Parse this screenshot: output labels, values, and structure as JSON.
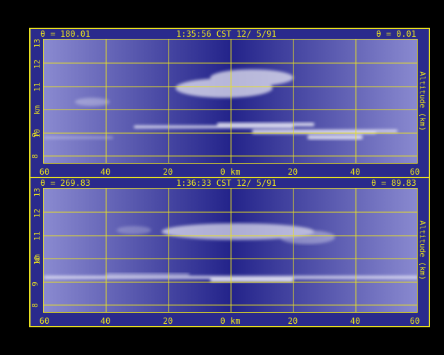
{
  "panels": [
    {
      "theta_left": "θ = 180.01",
      "time": "1:35:56 CST 12/ 5/91",
      "theta_right": "θ = 0.01",
      "y_axis_label": "km",
      "right_label": "Altitude (km)",
      "y_ticks": [
        "8",
        "9",
        "10",
        "11",
        "12",
        "13"
      ],
      "x_ticks": [
        "60",
        "40",
        "20",
        "0 km",
        "20",
        "40",
        "60"
      ]
    },
    {
      "theta_left": "θ = 269.83",
      "time": "1:36:33 CST 12/ 5/91",
      "theta_right": "θ = 89.83",
      "y_axis_label": "km",
      "right_label": "Altitude (km)",
      "y_ticks": [
        "8",
        "9",
        "10",
        "11",
        "12",
        "13"
      ],
      "x_ticks": [
        "60",
        "40",
        "20",
        "0 km",
        "20",
        "40",
        "60"
      ]
    }
  ],
  "colors": {
    "frame": "#e8e020",
    "background_dark": "#23238a",
    "background_light": "#8a8ad0",
    "cloud": "#e8e8f4"
  }
}
